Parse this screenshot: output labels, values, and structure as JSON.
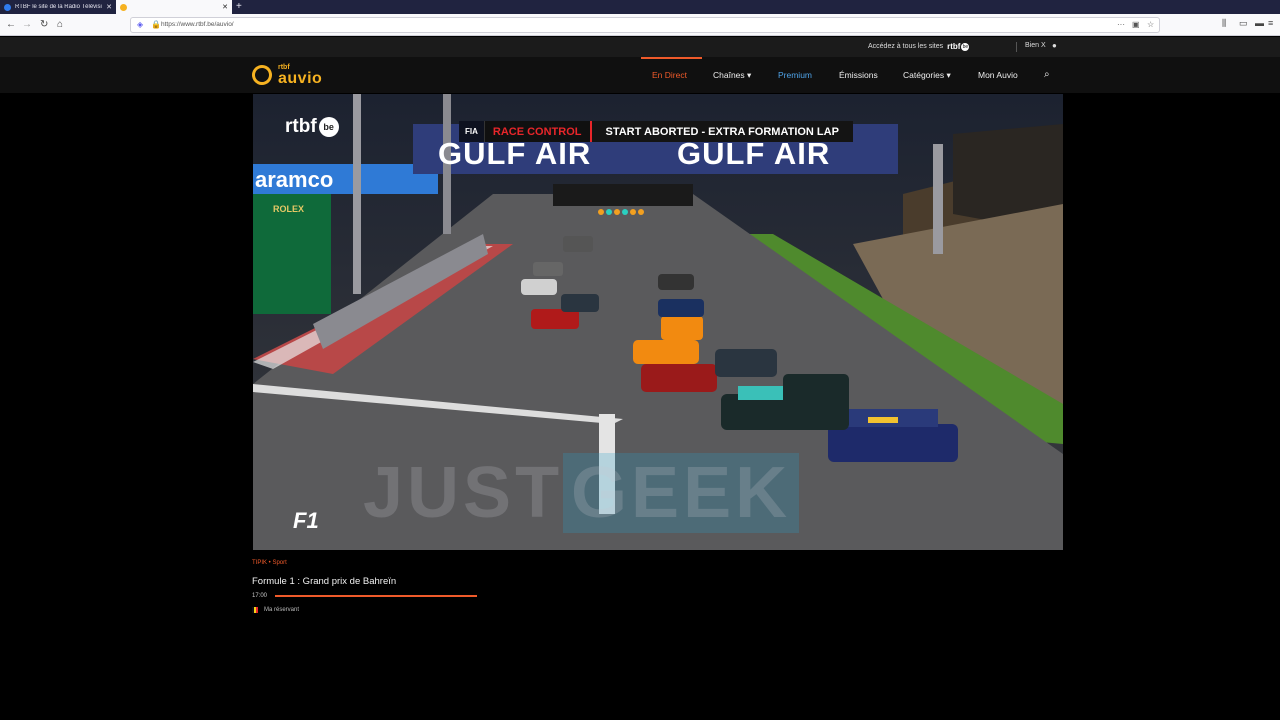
{
  "browser": {
    "tabs": [
      {
        "title": "RTBF le site de la Radio Télévisi",
        "close": "✕"
      },
      {
        "title": "",
        "close": "✕"
      }
    ],
    "new_tab": "+",
    "url": "https://www.rtbf.be/auvio/"
  },
  "topbar": {
    "access_text": "Accédez à tous les sites",
    "brand": "rtbf",
    "brand_be": "be",
    "user": "Bien X"
  },
  "header": {
    "logo_small": "rtbf",
    "logo_big": "auvio",
    "nav": [
      {
        "label": "En Direct"
      },
      {
        "label": "Chaînes ▾"
      },
      {
        "label": "Premium"
      },
      {
        "label": "Émissions"
      },
      {
        "label": "Catégories ▾"
      },
      {
        "label": "Mon Auvio"
      }
    ]
  },
  "video": {
    "channel_logo": "rtbf",
    "channel_logo_be": "be",
    "fia": "FIA",
    "race_control": "RACE CONTROL",
    "message": "START ABORTED - EXTRA FORMATION LAP",
    "gulf_left": "GULF AIR",
    "gulf_right": "GULF AIR",
    "rolex": "ROLEX",
    "aramco": "aramco",
    "f1": "F1",
    "watermark_a": "JUST",
    "watermark_b": "GEEK"
  },
  "program": {
    "meta": "TIPIK  •  Sport",
    "title": "Formule 1 : Grand prix de Bahreïn",
    "time": "17:00",
    "progress": 1.0,
    "language": "Ma réservant"
  },
  "colors": {
    "accent": "#ef5a2a",
    "premium": "#4fa3e8",
    "logo": "#f6b221"
  }
}
